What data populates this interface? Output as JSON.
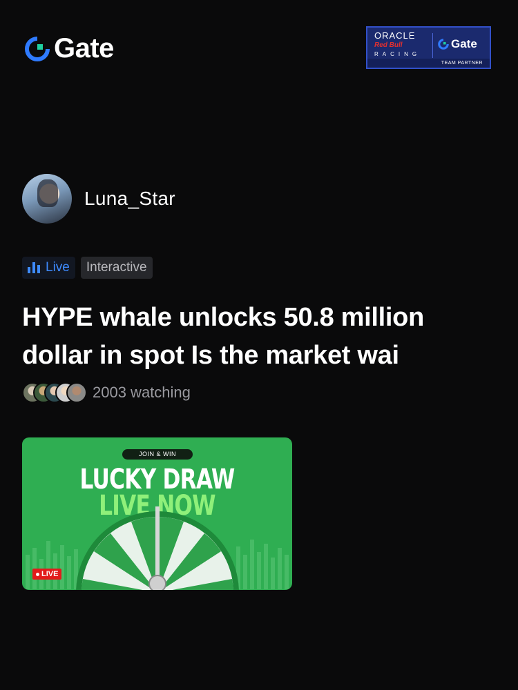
{
  "brand": {
    "logo_text": "Gate",
    "logo_icon": "gate-logo-icon"
  },
  "partner": {
    "oracle": "ORACLE",
    "redbull": "Red Bull",
    "racing": "RACING",
    "gate": "Gate",
    "team_partner": "TEAM PARTNER"
  },
  "author": {
    "name": "Luna_Star"
  },
  "tags": {
    "live": "Live",
    "interactive": "Interactive"
  },
  "post": {
    "title": "HYPE whale unlocks 50.8 million dollar in spot Is the market wai"
  },
  "viewers": {
    "label": "2003 watching"
  },
  "banner": {
    "join": "JOIN & WIN",
    "headline_1": "LUCKY DRAW",
    "headline_2": "LIVE NOW",
    "badge": "LIVE"
  },
  "colors": {
    "accent_blue": "#3e8bff",
    "banner_green": "#2fae52",
    "live_red": "#e21b1b"
  }
}
